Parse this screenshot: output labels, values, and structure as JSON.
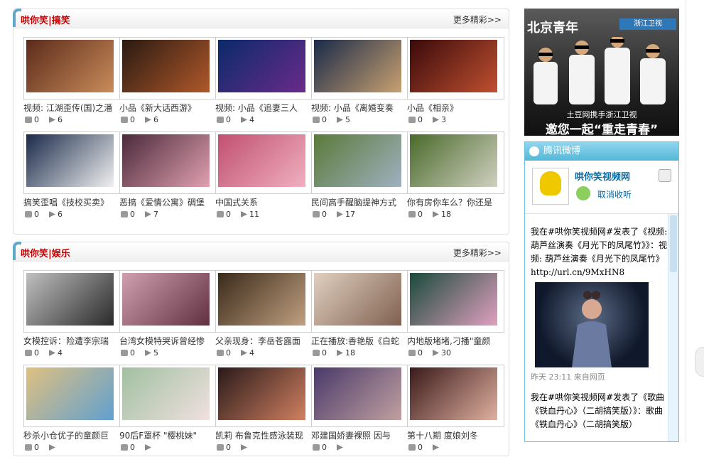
{
  "sections": [
    {
      "title": "哄你笑|搞笑",
      "more": "更多精彩>>",
      "items": [
        {
          "title": "视频: 江湖歪传(国)之潘",
          "comments": "0",
          "plays": "6",
          "c1": "#5b2a1a",
          "c2": "#c98c5a"
        },
        {
          "title": "小品《新大话西游》",
          "comments": "0",
          "plays": "6",
          "c1": "#2a1a12",
          "c2": "#b0582a"
        },
        {
          "title": "视频: 小品《追妻三人",
          "comments": "0",
          "plays": "4",
          "c1": "#0a2a6a",
          "c2": "#6a2a8a"
        },
        {
          "title": "视频: 小品《离婚变奏",
          "comments": "0",
          "plays": "5",
          "c1": "#1a2a4a",
          "c2": "#c8a070"
        },
        {
          "title": "小品《相亲》",
          "comments": "0",
          "plays": "3",
          "c1": "#3a0a0a",
          "c2": "#c05030"
        },
        {
          "title": "搞笑歪唱《技校买卖》",
          "comments": "0",
          "plays": "6",
          "c1": "#1a2a4a",
          "c2": "#f0f0f0"
        },
        {
          "title": "恶搞《爱情公寓》碉堡",
          "comments": "0",
          "plays": "7",
          "c1": "#4a2a3a",
          "c2": "#e0a0b0"
        },
        {
          "title": "中国式关系",
          "comments": "0",
          "plays": "11",
          "c1": "#c05070",
          "c2": "#f0b0c0"
        },
        {
          "title": "民间高手醒脑提神方式",
          "comments": "0",
          "plays": "17",
          "c1": "#5a7a3a",
          "c2": "#a0b0c0"
        },
        {
          "title": "你有房你车么？你还是",
          "comments": "0",
          "plays": "18",
          "c1": "#4a6a2a",
          "c2": "#d0d0c0"
        }
      ]
    },
    {
      "title": "哄你笑|娱乐",
      "more": "更多精彩>>",
      "items": [
        {
          "title": "女模控诉：险遭李宗瑞",
          "comments": "0",
          "plays": "4",
          "c1": "#c0c0c0",
          "c2": "#2a2a2a"
        },
        {
          "title": "台湾女模特哭诉曾经惨",
          "comments": "0",
          "plays": "5",
          "c1": "#d0a0b0",
          "c2": "#603040"
        },
        {
          "title": "父亲现身：李岳苍露面",
          "comments": "0",
          "plays": "4",
          "c1": "#3a2a1a",
          "c2": "#c0a080"
        },
        {
          "title": "正在播放:香艳版《白蛇",
          "comments": "0",
          "plays": "18",
          "c1": "#e0d0c0",
          "c2": "#806050"
        },
        {
          "title": "内地版堵堵,刁播\"童颜",
          "comments": "0",
          "plays": "30",
          "c1": "#1a4a3a",
          "c2": "#e0a0c0"
        },
        {
          "title": "秒杀小仓优子的童颜巨",
          "comments": "0",
          "plays": "",
          "c1": "#e0c080",
          "c2": "#60a0d0"
        },
        {
          "title": "90后F罩杯 \"樱桃妹\"",
          "comments": "0",
          "plays": "",
          "c1": "#a0c0a0",
          "c2": "#f0e0e0"
        },
        {
          "title": "凯莉 布鲁克性感泳装现",
          "comments": "0",
          "plays": "",
          "c1": "#2a1a1a",
          "c2": "#d08060"
        },
        {
          "title": "邓建国娇妻裸照 因与",
          "comments": "0",
          "plays": "",
          "c1": "#4a3a6a",
          "c2": "#c0a0a0"
        },
        {
          "title": "第十八期 度娘刘冬",
          "comments": "0",
          "plays": "",
          "c1": "#3a1a1a",
          "c2": "#e0b0a0"
        }
      ]
    }
  ],
  "ad": {
    "brand": "北京青年",
    "logo": "浙江卫视",
    "line1": "土豆网携手浙江卫视",
    "line2": "邀您一起“重走青春”"
  },
  "weibo": {
    "header": "腾讯微博",
    "name": "哄你笑视频网",
    "unfollow": "取消收听",
    "post1": "我在#哄你笑视频网#发表了《视频: 葫芦丝演奏《月光下的凤尾竹》》：视频: 葫芦丝演奏《月光下的凤尾竹》 http://url.cn/9MxHN8",
    "time1": "昨天 23:11 来自网页",
    "post2": "我在#哄你笑视频网#发表了《歌曲《铁血丹心》（二胡搞笑版）》：歌曲《铁血丹心》（二胡搞笑版）"
  }
}
